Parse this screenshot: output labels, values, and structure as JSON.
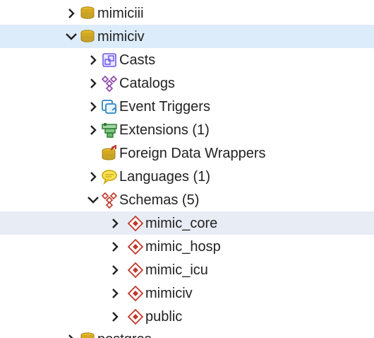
{
  "tree": {
    "nodes": [
      {
        "label": "mimiciii",
        "icon": "database-icon",
        "expander": "chevron-right"
      },
      {
        "label": "mimiciv",
        "icon": "database-icon",
        "expander": "chevron-down",
        "selected": true
      },
      {
        "label": "Casts",
        "icon": "casts-icon",
        "expander": "chevron-right"
      },
      {
        "label": "Catalogs",
        "icon": "catalogs-icon",
        "expander": "chevron-right"
      },
      {
        "label": "Event Triggers",
        "icon": "event-triggers-icon",
        "expander": "chevron-right"
      },
      {
        "label": "Extensions (1)",
        "icon": "extensions-icon",
        "expander": "chevron-right"
      },
      {
        "label": "Foreign Data Wrappers",
        "icon": "foreign-data-wrappers-icon",
        "expander": "none"
      },
      {
        "label": "Languages (1)",
        "icon": "languages-icon",
        "expander": "chevron-right"
      },
      {
        "label": "Schemas (5)",
        "icon": "schemas-icon",
        "expander": "chevron-down"
      },
      {
        "label": "mimic_core",
        "icon": "schema-icon",
        "expander": "chevron-right",
        "hovered": true
      },
      {
        "label": "mimic_hosp",
        "icon": "schema-icon",
        "expander": "chevron-right"
      },
      {
        "label": "mimic_icu",
        "icon": "schema-icon",
        "expander": "chevron-right"
      },
      {
        "label": "mimiciv",
        "icon": "schema-icon",
        "expander": "chevron-right"
      },
      {
        "label": "public",
        "icon": "schema-icon",
        "expander": "chevron-right"
      },
      {
        "label": "postgres",
        "icon": "database-icon",
        "expander": "chevron-right"
      }
    ]
  },
  "colors": {
    "selected_row": "#dcecfb",
    "hovered_row": "#e8ecf5",
    "database_gold": "#c9a227",
    "schema_red": "#c0392b",
    "catalog_purple": "#8e44ad",
    "casts_purple": "#6c5ce7",
    "trigger_blue": "#2e86c1",
    "extension_green": "#2e7d32",
    "language_yellow": "#f4d03f"
  }
}
